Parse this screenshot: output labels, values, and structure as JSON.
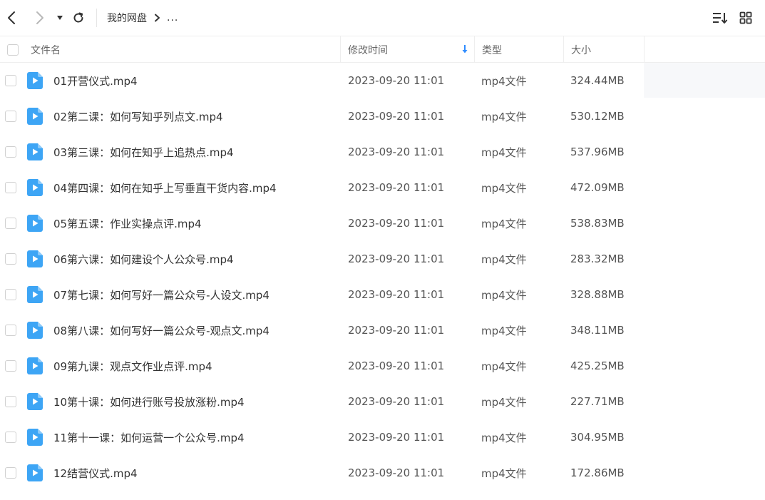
{
  "toolbar": {
    "breadcrumb_root": "我的网盘",
    "breadcrumb_more": "..."
  },
  "header": {
    "name": "文件名",
    "time": "修改时间",
    "type": "类型",
    "size": "大小"
  },
  "colors": {
    "accent": "#2f8cff",
    "file_icon": "#3da5f5"
  },
  "files": [
    {
      "name": "01开营仪式.mp4",
      "time": "2023-09-20 11:01",
      "type": "mp4文件",
      "size": "324.44MB"
    },
    {
      "name": "02第二课：如何写知乎列点文.mp4",
      "time": "2023-09-20 11:01",
      "type": "mp4文件",
      "size": "530.12MB"
    },
    {
      "name": "03第三课：如何在知乎上追热点.mp4",
      "time": "2023-09-20 11:01",
      "type": "mp4文件",
      "size": "537.96MB"
    },
    {
      "name": "04第四课：如何在知乎上写垂直干货内容.mp4",
      "time": "2023-09-20 11:01",
      "type": "mp4文件",
      "size": "472.09MB"
    },
    {
      "name": "05第五课：作业实操点评.mp4",
      "time": "2023-09-20 11:01",
      "type": "mp4文件",
      "size": "538.83MB"
    },
    {
      "name": "06第六课：如何建设个人公众号.mp4",
      "time": "2023-09-20 11:01",
      "type": "mp4文件",
      "size": "283.32MB"
    },
    {
      "name": "07第七课：如何写好一篇公众号-人设文.mp4",
      "time": "2023-09-20 11:01",
      "type": "mp4文件",
      "size": "328.88MB"
    },
    {
      "name": "08第八课：如何写好一篇公众号-观点文.mp4",
      "time": "2023-09-20 11:01",
      "type": "mp4文件",
      "size": "348.11MB"
    },
    {
      "name": "09第九课：观点文作业点评.mp4",
      "time": "2023-09-20 11:01",
      "type": "mp4文件",
      "size": "425.25MB"
    },
    {
      "name": "10第十课：如何进行账号投放涨粉.mp4",
      "time": "2023-09-20 11:01",
      "type": "mp4文件",
      "size": "227.71MB"
    },
    {
      "name": "11第十一课：如何运营一个公众号.mp4",
      "time": "2023-09-20 11:01",
      "type": "mp4文件",
      "size": "304.95MB"
    },
    {
      "name": "12结营仪式.mp4",
      "time": "2023-09-20 11:01",
      "type": "mp4文件",
      "size": "172.86MB"
    }
  ]
}
